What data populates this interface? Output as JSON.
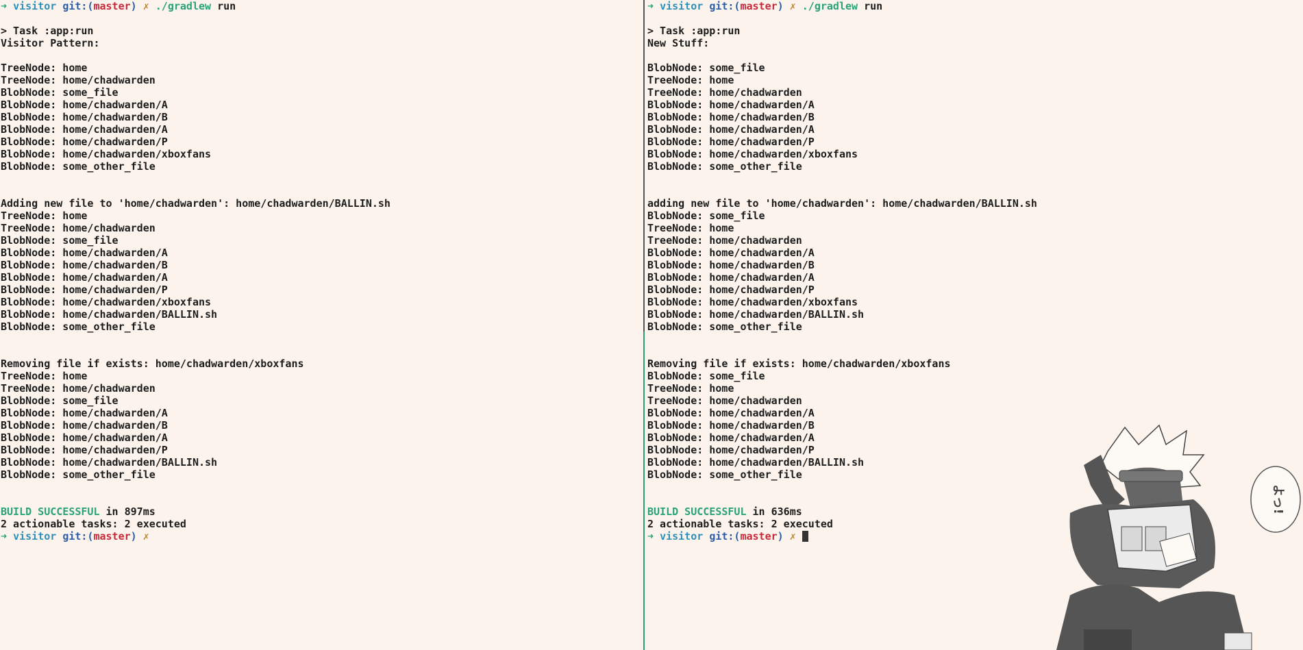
{
  "prompt": {
    "arrow": "➜",
    "dir": "visitor",
    "git_label": "git:(",
    "branch": "master",
    "git_close": ")",
    "dirty_mark": "✗",
    "command": "./gradlew",
    "arg": "run"
  },
  "left": {
    "lines": [
      "",
      "> Task :app:run",
      "Visitor Pattern:",
      "",
      "TreeNode: home",
      "TreeNode: home/chadwarden",
      "BlobNode: some_file",
      "BlobNode: home/chadwarden/A",
      "BlobNode: home/chadwarden/B",
      "BlobNode: home/chadwarden/A",
      "BlobNode: home/chadwarden/P",
      "BlobNode: home/chadwarden/xboxfans",
      "BlobNode: some_other_file",
      "",
      "",
      "Adding new file to 'home/chadwarden': home/chadwarden/BALLIN.sh",
      "TreeNode: home",
      "TreeNode: home/chadwarden",
      "BlobNode: some_file",
      "BlobNode: home/chadwarden/A",
      "BlobNode: home/chadwarden/B",
      "BlobNode: home/chadwarden/A",
      "BlobNode: home/chadwarden/P",
      "BlobNode: home/chadwarden/xboxfans",
      "BlobNode: home/chadwarden/BALLIN.sh",
      "BlobNode: some_other_file",
      "",
      "",
      "Removing file if exists: home/chadwarden/xboxfans",
      "TreeNode: home",
      "TreeNode: home/chadwarden",
      "BlobNode: some_file",
      "BlobNode: home/chadwarden/A",
      "BlobNode: home/chadwarden/B",
      "BlobNode: home/chadwarden/A",
      "BlobNode: home/chadwarden/P",
      "BlobNode: home/chadwarden/BALLIN.sh",
      "BlobNode: some_other_file",
      "",
      ""
    ],
    "build_label": "BUILD SUCCESSFUL",
    "build_time": " in 897ms",
    "tasks": "2 actionable tasks: 2 executed"
  },
  "right": {
    "lines": [
      "",
      "> Task :app:run",
      "New Stuff:",
      "",
      "BlobNode: some_file",
      "TreeNode: home",
      "TreeNode: home/chadwarden",
      "BlobNode: home/chadwarden/A",
      "BlobNode: home/chadwarden/B",
      "BlobNode: home/chadwarden/A",
      "BlobNode: home/chadwarden/P",
      "BlobNode: home/chadwarden/xboxfans",
      "BlobNode: some_other_file",
      "",
      "",
      "adding new file to 'home/chadwarden': home/chadwarden/BALLIN.sh",
      "BlobNode: some_file",
      "TreeNode: home",
      "TreeNode: home/chadwarden",
      "BlobNode: home/chadwarden/A",
      "BlobNode: home/chadwarden/B",
      "BlobNode: home/chadwarden/A",
      "BlobNode: home/chadwarden/P",
      "BlobNode: home/chadwarden/xboxfans",
      "BlobNode: home/chadwarden/BALLIN.sh",
      "BlobNode: some_other_file",
      "",
      "",
      "Removing file if exists: home/chadwarden/xboxfans",
      "BlobNode: some_file",
      "TreeNode: home",
      "TreeNode: home/chadwarden",
      "BlobNode: home/chadwarden/A",
      "BlobNode: home/chadwarden/B",
      "BlobNode: home/chadwarden/A",
      "BlobNode: home/chadwarden/P",
      "BlobNode: home/chadwarden/BALLIN.sh",
      "BlobNode: some_other_file",
      "",
      ""
    ],
    "build_label": "BUILD SUCCESSFUL",
    "build_time": " in 636ms",
    "tasks": "2 actionable tasks: 2 executed"
  },
  "colors": {
    "background": "#fcf4ec",
    "divider_inactive": "#555555",
    "divider_active": "#2aa278"
  },
  "decoration": {
    "speech_text": "よっ!"
  }
}
